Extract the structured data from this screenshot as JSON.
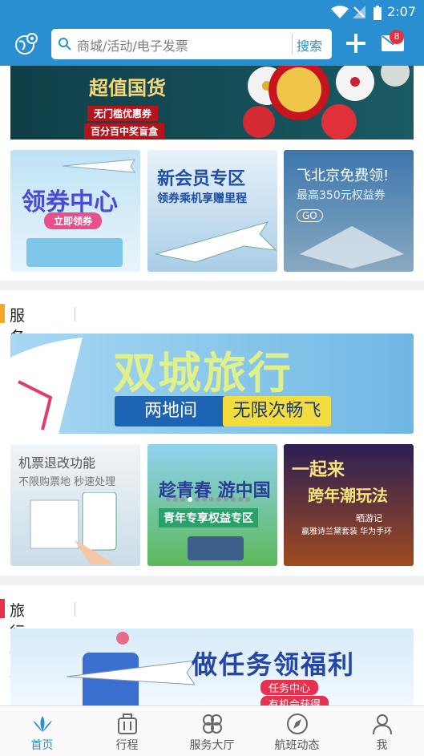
{
  "status_bar": {
    "time": "2:07"
  },
  "header": {
    "search_placeholder": "商城/活动/电子发票",
    "search_button": "搜索",
    "mail_badge": "8"
  },
  "top_banner": {
    "title": "超值国货",
    "tag1": "无门槛优惠券",
    "tag2": "百分百中奖盲盒"
  },
  "promo_cards": [
    {
      "title": "领券中心",
      "button": "立即领券"
    },
    {
      "title": "新会员专区",
      "subtitle": "领券乘机享赠里程"
    },
    {
      "title": "飞北京免费领!",
      "subtitle": "最高350元权益券",
      "button": "GO"
    }
  ],
  "service_section": {
    "title": "服务专区",
    "banner": {
      "title": "双城旅行",
      "left": "两地间",
      "right": "无限次畅飞"
    },
    "cards": [
      {
        "title": "机票退改功能",
        "subtitle": "不限购票地 秒速处理"
      },
      {
        "title": "趁青春 游中国",
        "subtitle": "青年专享权益专区"
      },
      {
        "title": "一起来",
        "subtitle": "跨年潮玩法",
        "note1": "晒游记",
        "note2": "赢雅诗兰黛套装 华为手环"
      }
    ]
  },
  "travel_section": {
    "title": "旅行情报",
    "banner": {
      "title": "做任务领福利",
      "line1": "任务中心",
      "line2": "有机会获得"
    }
  },
  "tabs": [
    {
      "label": "首页",
      "icon": "home-logo-icon"
    },
    {
      "label": "行程",
      "icon": "luggage-icon"
    },
    {
      "label": "服务大厅",
      "icon": "clover-grid-icon"
    },
    {
      "label": "航班动态",
      "icon": "compass-icon"
    },
    {
      "label": "我",
      "icon": "person-icon"
    }
  ],
  "colors": {
    "brand_blue": "#2a8fd1",
    "service_accent": "#f5a623",
    "travel_accent": "#e8304f"
  }
}
